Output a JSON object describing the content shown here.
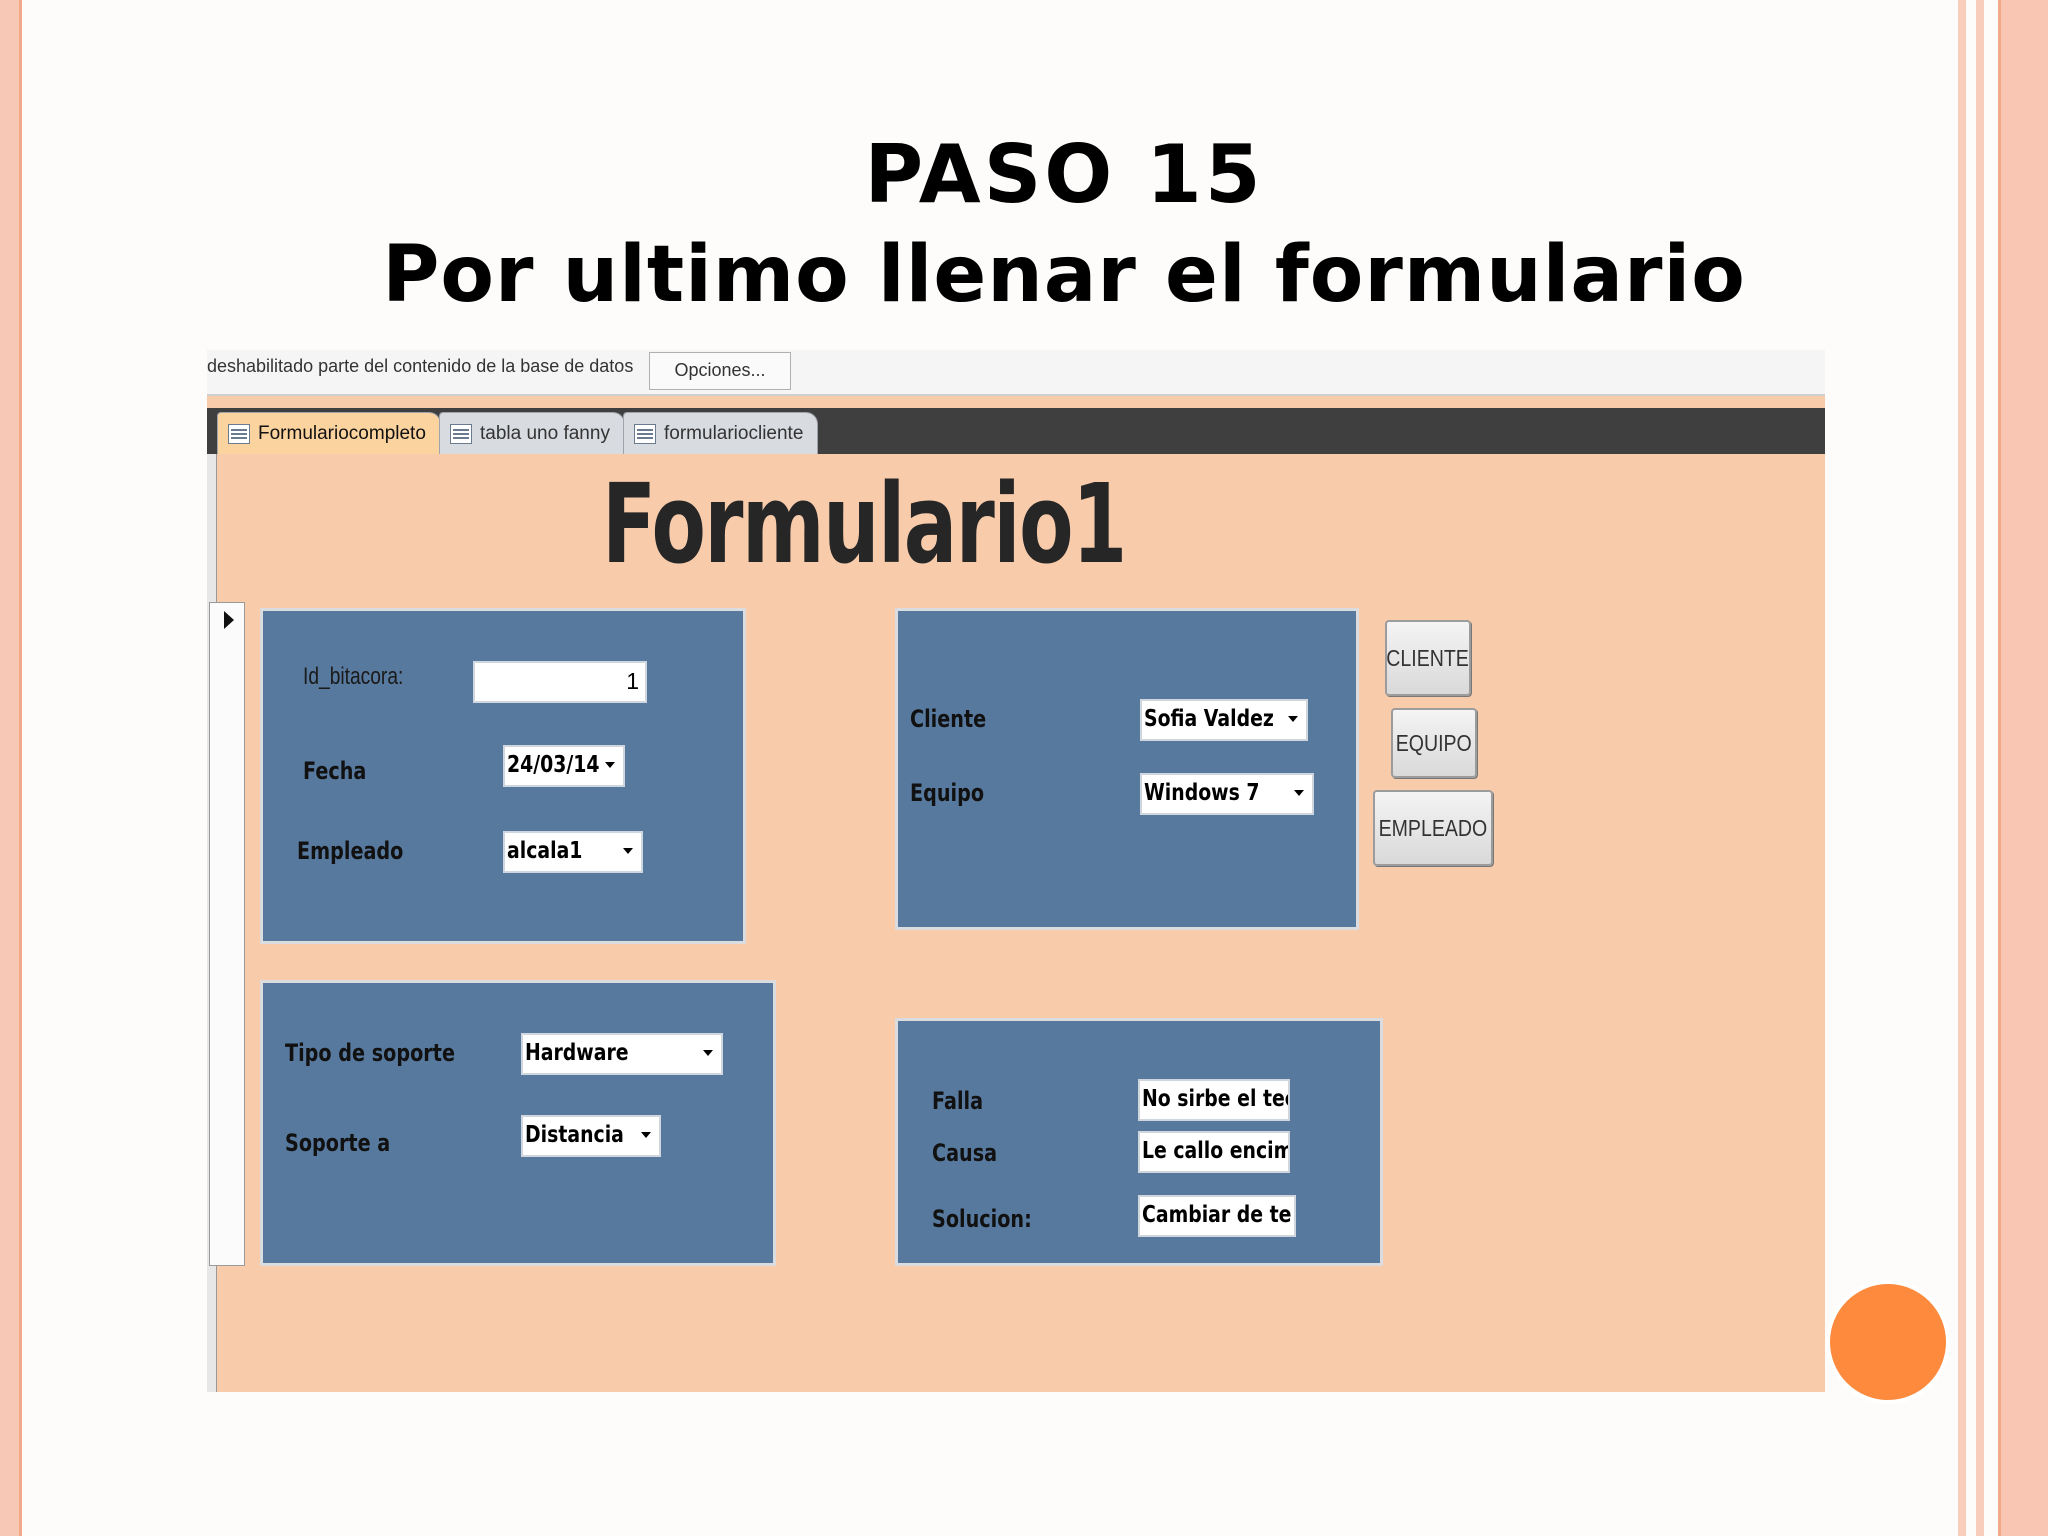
{
  "slide": {
    "title_line1": "PASO 15",
    "title_line2": "Por ultimo llenar el formulario"
  },
  "message_bar": {
    "text": "deshabilitado parte del contenido de la base de datos",
    "options_button": "Opciones..."
  },
  "tabs": [
    {
      "label": "Formulariocompleto",
      "icon": "form-icon",
      "active": true
    },
    {
      "label": "tabla uno fanny",
      "icon": "table-icon",
      "active": false
    },
    {
      "label": "formulariocliente",
      "icon": "form-icon",
      "active": false
    }
  ],
  "form": {
    "title": "Formulario1",
    "panel_a": {
      "id_label": "Id_bitacora:",
      "id_value": "1",
      "fecha_label": "Fecha",
      "fecha_value": "24/03/14",
      "empleado_label": "Empleado",
      "empleado_value": "alcala1"
    },
    "panel_b": {
      "cliente_label": "Cliente",
      "cliente_value": "Sofia Valdez",
      "equipo_label": "Equipo",
      "equipo_value": "Windows 7"
    },
    "panel_c": {
      "tipo_label": "Tipo de soporte",
      "tipo_value": "Hardware",
      "soporte_label": "Soporte a",
      "soporte_value": "Distancia"
    },
    "panel_d": {
      "falla_label": "Falla",
      "falla_value": "No sirbe el tec",
      "causa_label": "Causa",
      "causa_value": "Le callo encim",
      "solucion_label": "Solucion:",
      "solucion_value": "Cambiar de te"
    },
    "buttons": {
      "cliente": "CLIENTE",
      "equipo": "EQUIPO",
      "empleado": "EMPLEADO"
    }
  },
  "colors": {
    "form_background": "#f8cbaa",
    "panel": "#58799e",
    "accent_dot": "#fd8a3d"
  }
}
